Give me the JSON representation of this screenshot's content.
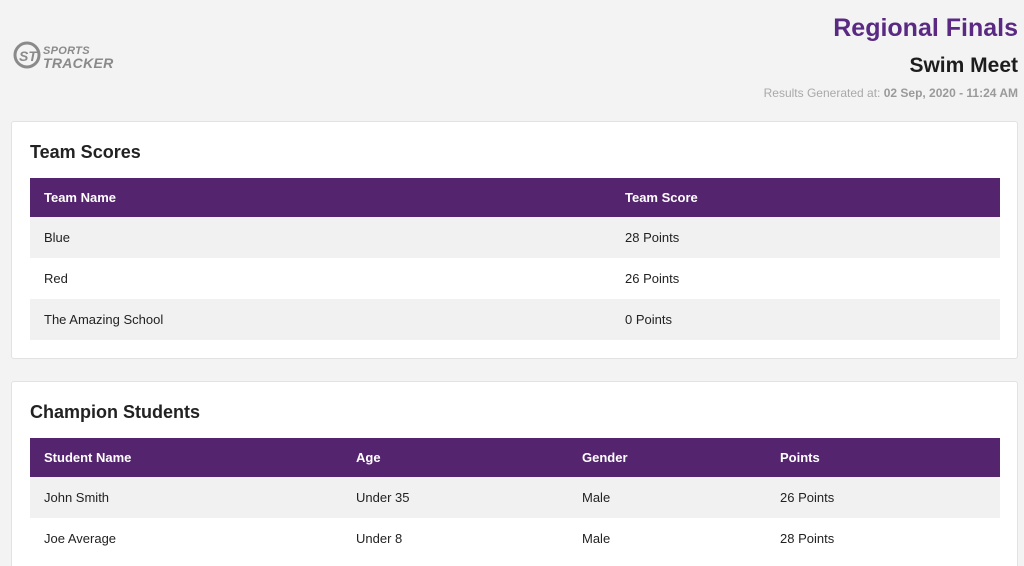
{
  "header": {
    "logo": {
      "line1": "SPORTS",
      "line2": "TRACKER"
    },
    "title": "Regional Finals",
    "subtitle": "Swim Meet",
    "generated_label": "Results Generated at:",
    "generated_value": "02 Sep, 2020 - 11:24 AM"
  },
  "team_scores": {
    "title": "Team Scores",
    "columns": [
      "Team Name",
      "Team Score"
    ],
    "rows": [
      [
        "Blue",
        "28 Points"
      ],
      [
        "Red",
        "26 Points"
      ],
      [
        "The Amazing School",
        "0 Points"
      ]
    ]
  },
  "champion_students": {
    "title": "Champion Students",
    "columns": [
      "Student Name",
      "Age",
      "Gender",
      "Points"
    ],
    "rows": [
      [
        "John Smith",
        "Under 35",
        "Male",
        "26 Points"
      ],
      [
        "Joe Average",
        "Under 8",
        "Male",
        "28 Points"
      ]
    ]
  },
  "colors": {
    "brand_purple": "#55246f",
    "title_purple": "#5a2a82",
    "row_shade": "#f1f1f1",
    "page_bg": "#f3f3f4"
  }
}
